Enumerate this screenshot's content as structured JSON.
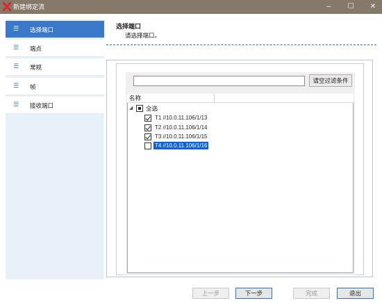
{
  "window": {
    "title": "新建绑定流",
    "minimize_label": "–",
    "maximize_label": "☐",
    "close_label": "✕"
  },
  "colors": {
    "titlebar": "#85796a",
    "accent": "#3a78c9",
    "selection": "#0a64d8",
    "sidebar_bg": "#e8f0f9"
  },
  "sidebar": {
    "items": [
      {
        "label": "选择端口",
        "icon": "menu-lines-icon",
        "active": true
      },
      {
        "label": "端点",
        "icon": "menu-lines-icon",
        "active": false
      },
      {
        "label": "常规",
        "icon": "menu-lines-icon",
        "active": false
      },
      {
        "label": "帧",
        "icon": "menu-lines-icon",
        "active": false
      },
      {
        "label": "接收端口",
        "icon": "menu-lines-icon",
        "active": false
      }
    ]
  },
  "header": {
    "title": "选择端口",
    "subtitle": "请选择端口。"
  },
  "filter": {
    "value": "",
    "placeholder": "",
    "clear_label": "请空过滤条件"
  },
  "tree": {
    "column_header": "名称",
    "root_label": "全选",
    "root_state": "partial",
    "ports": [
      {
        "label": "T1 //10.0.11.106/1/13",
        "checked": true,
        "selected": false
      },
      {
        "label": "T2 //10.0.11.106/1/14",
        "checked": true,
        "selected": false
      },
      {
        "label": "T3 //10.0.11.106/1/15",
        "checked": true,
        "selected": false
      },
      {
        "label": "T4 //10.0.11.106/1/16",
        "checked": false,
        "selected": true
      }
    ]
  },
  "footer": {
    "prev_label": "上一步",
    "next_label": "下一步",
    "finish_label": "完成",
    "exit_label": "退出"
  }
}
